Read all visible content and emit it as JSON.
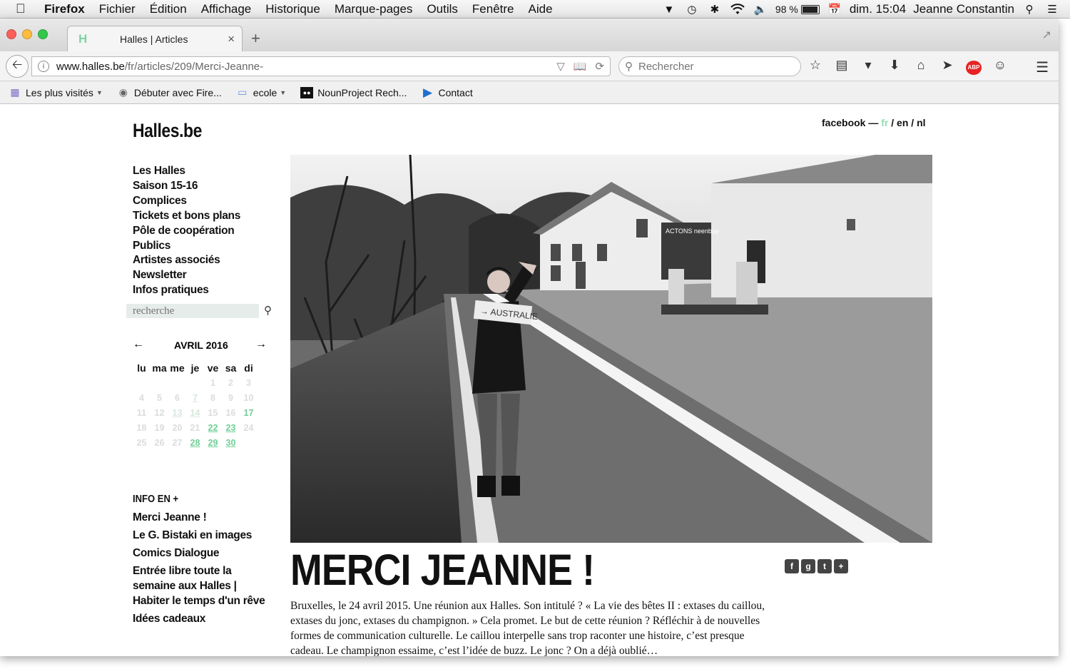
{
  "menubar": {
    "items": [
      "Firefox",
      "Fichier",
      "Édition",
      "Affichage",
      "Historique",
      "Marque-pages",
      "Outils",
      "Fenêtre",
      "Aide"
    ],
    "battery": "98 %",
    "clock": "dim. 15:04",
    "user": "Jeanne Constantin"
  },
  "browser": {
    "tab_title": "Halles | Articles",
    "url_domain": "www.halles.be",
    "url_path": "/fr/articles/209/Merci-Jeanne-",
    "search_placeholder": "Rechercher",
    "bookmarks": [
      {
        "label": "Les plus visités",
        "icon": "folder-smart-icon",
        "dropdown": true
      },
      {
        "label": "Débuter avec Fire...",
        "icon": "globe-icon",
        "dropdown": false
      },
      {
        "label": "ecole",
        "icon": "folder-icon",
        "dropdown": true
      },
      {
        "label": "NounProject Rech...",
        "icon": "nounproject-icon",
        "dropdown": false
      },
      {
        "label": "Contact",
        "icon": "play-circle-icon",
        "dropdown": false
      }
    ]
  },
  "site": {
    "logo": "Halles.be",
    "topright": {
      "facebook": "facebook —",
      "fr": "fr",
      "en": "/ en /",
      "nl": "nl"
    },
    "nav": [
      "Les Halles",
      "Saison 15-16",
      "Complices",
      "Tickets et bons plans",
      "Pôle de coopération",
      "Publics",
      "Artistes associés",
      "Newsletter",
      "Infos pratiques"
    ],
    "search_placeholder": "recherche",
    "calendar": {
      "prev": "←",
      "next": "→",
      "month": "AVRIL 2016",
      "day_names": [
        "lu",
        "ma",
        "me",
        "je",
        "ve",
        "sa",
        "di"
      ],
      "leading_blanks": 4,
      "days": 30,
      "today": 17,
      "past_links": [
        7,
        13,
        14
      ],
      "upcoming_links": [
        22,
        23,
        28,
        29,
        30
      ]
    },
    "info_title": "INFO EN +",
    "info_links": [
      "Merci Jeanne !",
      "Le G. Bistaki en images",
      "Comics Dialogue",
      "Entrée libre toute la semaine aux Halles | Habiter le temps d'un rêve",
      "Idées cadeaux"
    ],
    "article": {
      "title": "MERCI JEANNE !",
      "sign_text": "→ AUSTRALIE",
      "shop_text": "ACTONS  neenbuy",
      "body": "Bruxelles, le 24 avril 2015. Une réunion aux Halles. Son intitulé ? « La vie des bêtes II : extases du caillou, extases du jonc, extases du champignon. » Cela promet. Le but de cette réunion ? Réfléchir à de nouvelles formes de communication culturelle. Le caillou interpelle sans trop raconter une histoire, c’est presque cadeau. Le champignon essaime, c’est l’idée de buzz. Le jonc ? On a déjà oublié…"
    },
    "share_icons": [
      "facebook-icon",
      "google-plus-icon",
      "twitter-icon",
      "add-icon"
    ]
  }
}
